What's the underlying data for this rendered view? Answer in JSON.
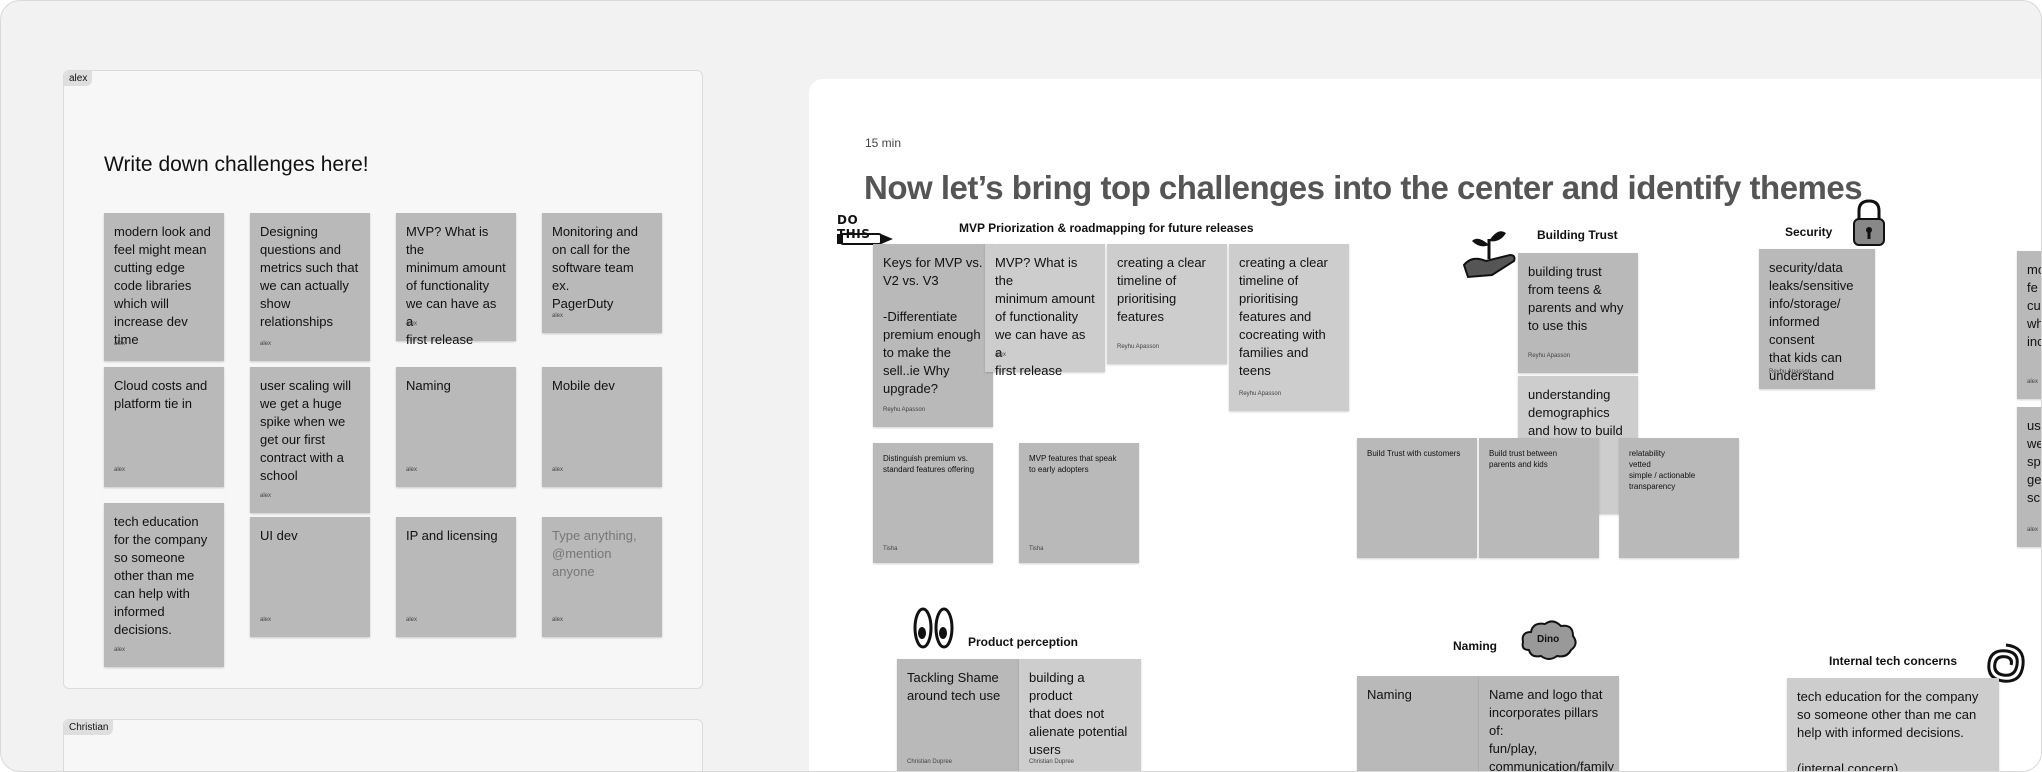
{
  "left_frames": [
    {
      "owner": "alex",
      "heading": "Write down challenges here!"
    },
    {
      "owner": "Christian"
    }
  ],
  "alex_stickies": [
    {
      "text": "modern look and\nfeel might mean\ncutting edge\ncode libraries\nwhich will\nincrease dev time",
      "author": "alex"
    },
    {
      "text": "Designing\nquestions and\nmetrics such that\nwe can actually\nshow\nrelationships",
      "author": "alex"
    },
    {
      "text": "MVP? What is the\nminimum amount\nof functionality\nwe can have as a\nfirst release",
      "author": "alex"
    },
    {
      "text": "Monitoring and\non call for the\nsoftware team ex.\nPagerDuty",
      "author": "alex"
    },
    {
      "text": "Cloud costs and\nplatform tie in",
      "author": "alex"
    },
    {
      "text": "user scaling will\nwe get a huge\nspike when we\nget our first\ncontract with a\nschool",
      "author": "alex"
    },
    {
      "text": "Naming",
      "author": "alex"
    },
    {
      "text": "Mobile dev",
      "author": "alex"
    },
    {
      "text": "tech education\nfor the company\nso someone\nother than me\ncan help with\ninformed\ndecisions.",
      "author": "alex"
    },
    {
      "text": "UI dev",
      "author": "alex"
    },
    {
      "text": "IP and licensing",
      "author": "alex"
    },
    {
      "text": "Type anything,\n@mention\nanyone",
      "author": "alex"
    }
  ],
  "board": {
    "duration": "15 min",
    "title": "Now let’s bring top challenges into the center and identify themes",
    "sticker_do_this": "DO THIS",
    "sticker_dino": "Dino",
    "themes": {
      "mvp": "MVP Priorization & roadmapping for future releases",
      "trust": "Building Trust",
      "security": "Security",
      "perception": "Product perception",
      "naming": "Naming",
      "internal": "Internal tech concerns"
    },
    "stickies": [
      {
        "text": "Keys for MVP vs.\nV2 vs. V3\n\n-Differentiate\npremium enough\nto make the\nsell..ie Why\nupgrade?",
        "author": "Reyhu Apasson"
      },
      {
        "text": "MVP? What is the\nminimum amount\nof functionality\nwe can have as a\nfirst release",
        "author": "alex"
      },
      {
        "text": "creating a clear\ntimeline of\nprioritising\nfeatures",
        "author": "Reyhu Apasson"
      },
      {
        "text": "creating a clear\ntimeline of\nprioritising\nfeatures and\ncocreating with\nfamilies and\nteens",
        "author": "Reyhu Apasson"
      },
      {
        "text": "Distinguish premium  vs.\nstandard features offering",
        "author": "Tisha"
      },
      {
        "text": "MVP features that speak\nto early adopters",
        "author": "Tisha"
      },
      {
        "text": "building trust\nfrom teens &\nparents and why\nto use this",
        "author": "Reyhu Apasson"
      },
      {
        "text": "understanding\ndemographics\nand how to build\ne",
        "author": ""
      },
      {
        "text": "Build Trust with customers",
        "author": ""
      },
      {
        "text": "Build trust between\nparents and kids",
        "author": ""
      },
      {
        "text": "relatability\nvetted\nsimple / actionable\ntransparency",
        "author": ""
      },
      {
        "text": "security/data\nleaks/sensitive\ninfo/storage/\ninformed consent\nthat kids can\nunderstand",
        "author": "Reyhu Apasson"
      },
      {
        "text": "mo\nfe\ncu\nwh\ninc",
        "author": "alex"
      },
      {
        "text": "us\nwe\nsp\nge\nsc",
        "author": "alex"
      },
      {
        "text": "Tackling Shame\naround tech use",
        "author": "Christian Dupree"
      },
      {
        "text": "building a product\nthat does not\nalienate potential\nusers",
        "author": "Christian Dupree"
      },
      {
        "text": "Naming",
        "author": ""
      },
      {
        "text": "Name and logo that\nincorporates pillars of:\nfun/play,\ncommunication/family\nsystems/healthy",
        "author": ""
      },
      {
        "text": "tech education for the company\nso someone other than me can\nhelp with informed decisions.\n\n(internal concern)",
        "author": ""
      }
    ]
  }
}
